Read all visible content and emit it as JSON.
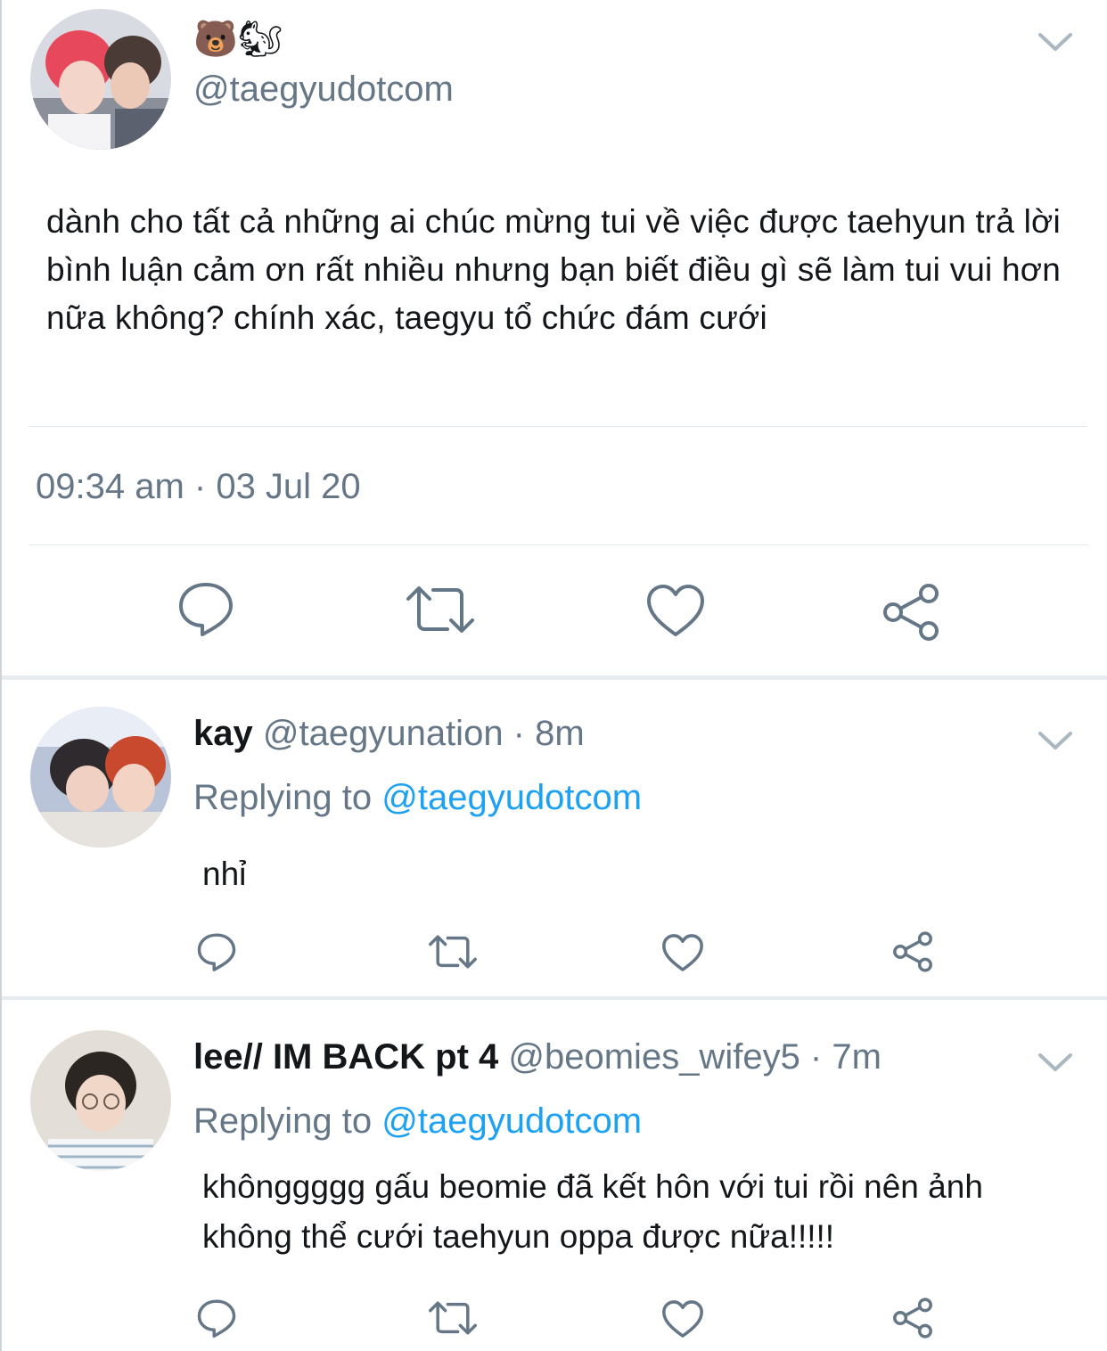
{
  "main_tweet": {
    "display_name": "🐻🐿",
    "handle": "@taegyudotcom",
    "text": "dành cho tất cả những ai chúc mừng tui về việc được taehyun trả lời bình luận cảm ơn rất nhiều nhưng bạn biết điều gì sẽ làm tui vui hơn nữa không? chính xác, taegyu tổ chức đám cưới",
    "timestamp": "09:34 am · 03 Jul 20"
  },
  "replies": [
    {
      "name": "kay",
      "handle": "@taegyunation",
      "time": " · 8m",
      "replying_label": "Replying to ",
      "replying_to": "@taegyudotcom",
      "text": "nhỉ"
    },
    {
      "name": "lee// IM BACK pt 4",
      "handle": "@beomies_wifey5",
      "time": " · 7m",
      "replying_label": "Replying to ",
      "replying_to": "@taegyudotcom",
      "text": "khônggggg gấu beomie đã kết hôn với tui rồi nên ảnh không thể cưới taehyun oppa được nữa!!!!!"
    }
  ],
  "colors": {
    "icon": "#657786",
    "link": "#1da1f2",
    "text": "#14171a",
    "divider": "#e1e8ed"
  },
  "icons": [
    "reply-icon",
    "retweet-icon",
    "like-icon",
    "share-icon",
    "chevron-down-icon"
  ]
}
